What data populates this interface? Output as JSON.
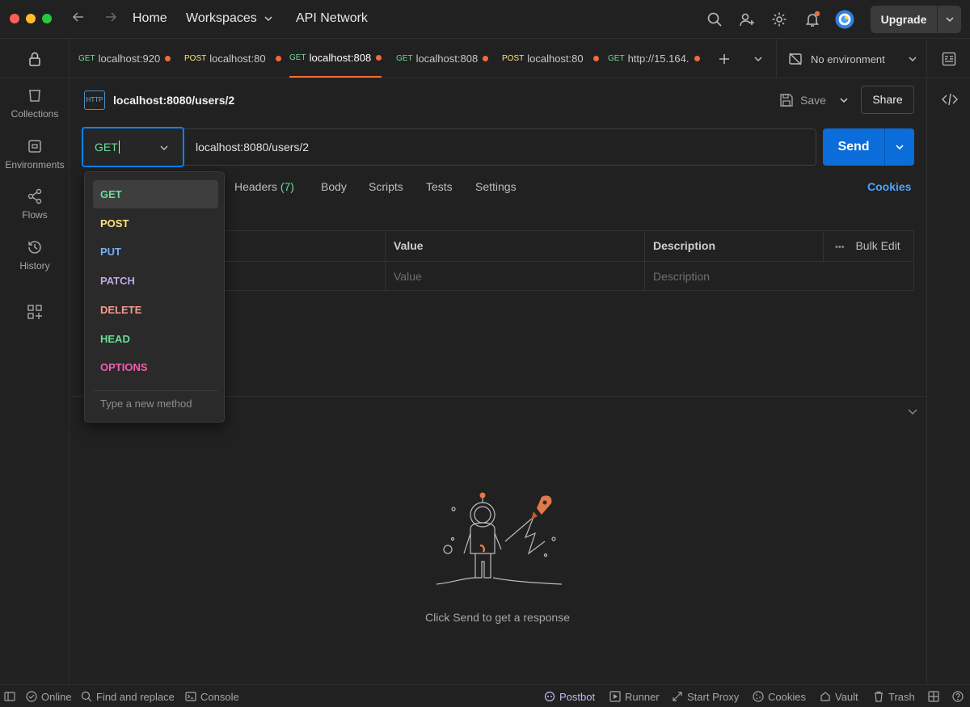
{
  "titlebar": {
    "home_label": "Home",
    "workspaces_label": "Workspaces",
    "api_network_label": "API Network",
    "upgrade_label": "Upgrade"
  },
  "sidebar": {
    "items": [
      {
        "label": "Collections"
      },
      {
        "label": "Environments"
      },
      {
        "label": "Flows"
      },
      {
        "label": "History"
      }
    ]
  },
  "tabs": [
    {
      "method": "GET",
      "title": "localhost:920",
      "active": false
    },
    {
      "method": "POST",
      "title": "localhost:80",
      "active": false
    },
    {
      "method": "GET",
      "title": "localhost:808",
      "active": true
    },
    {
      "method": "GET",
      "title": "localhost:808",
      "active": false
    },
    {
      "method": "POST",
      "title": "localhost:80",
      "active": false
    },
    {
      "method": "GET",
      "title": "http://15.164.",
      "active": false
    }
  ],
  "environment": {
    "label": "No environment"
  },
  "request": {
    "name": "localhost:8080/users/2",
    "http_badge": "HTTP",
    "save_label": "Save",
    "share_label": "Share",
    "method": "GET",
    "url": "localhost:8080/users/2",
    "send_label": "Send"
  },
  "subtabs": {
    "headers_label": "Headers",
    "headers_count": "(7)",
    "body_label": "Body",
    "scripts_label": "Scripts",
    "tests_label": "Tests",
    "settings_label": "Settings",
    "cookies_label": "Cookies"
  },
  "params_table": {
    "headers": [
      "Value",
      "Description"
    ],
    "bulk_edit_label": "Bulk Edit",
    "placeholders": [
      "Value",
      "Description"
    ]
  },
  "method_dropdown": {
    "items": [
      {
        "label": "GET",
        "color": "#6bdd9a",
        "selected": true
      },
      {
        "label": "POST",
        "color": "#ffe47e",
        "selected": false
      },
      {
        "label": "PUT",
        "color": "#74aef6",
        "selected": false
      },
      {
        "label": "PATCH",
        "color": "#c0a8e1",
        "selected": false
      },
      {
        "label": "DELETE",
        "color": "#f79a8e",
        "selected": false
      },
      {
        "label": "HEAD",
        "color": "#6bdd9a",
        "selected": false
      },
      {
        "label": "OPTIONS",
        "color": "#f15eb0",
        "selected": false
      }
    ],
    "new_method_placeholder": "Type a new method"
  },
  "response": {
    "empty_message": "Click Send to get a response"
  },
  "statusbar": {
    "online": "Online",
    "find_replace": "Find and replace",
    "console": "Console",
    "postbot": "Postbot",
    "runner": "Runner",
    "start_proxy": "Start Proxy",
    "cookies": "Cookies",
    "vault": "Vault",
    "trash": "Trash"
  },
  "colors": {
    "accent": "#ff6c37",
    "send_blue": "#0a6dd9",
    "focus_blue": "#0a84ff",
    "get_green": "#6bdd9a",
    "post_yellow": "#ffe47e",
    "unsaved_dot": "#f26b3a"
  }
}
